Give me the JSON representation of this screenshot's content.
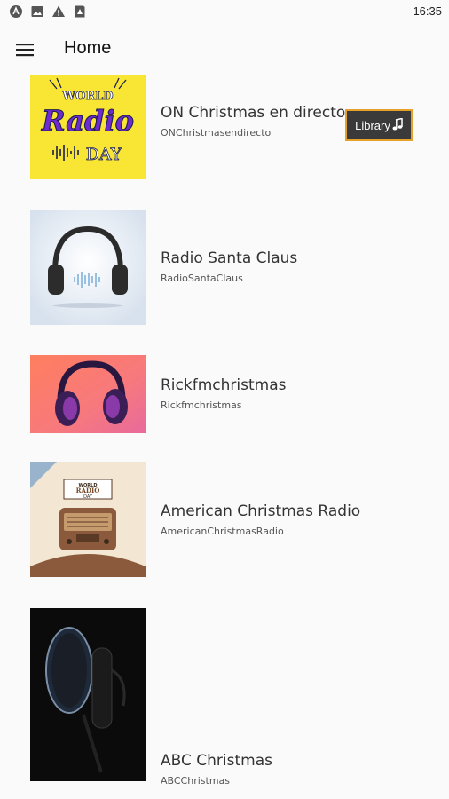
{
  "status_bar": {
    "time": "16:35",
    "icons": [
      "app-a-icon",
      "image-icon",
      "warning-icon",
      "sd-card-icon"
    ]
  },
  "app_bar": {
    "menu_icon": "hamburger-menu-icon",
    "title": "Home"
  },
  "library_badge": {
    "label": "Library",
    "icon": "music-note-icon"
  },
  "stations": [
    {
      "title": "ON Christmas en directo",
      "subtitle": "ONChristmasendirecto",
      "artwork": "world-radio-day",
      "art_text": [
        "WORLD",
        "Radio",
        "DAY"
      ]
    },
    {
      "title": "Radio Santa Claus",
      "subtitle": "RadioSantaClaus",
      "artwork": "white-headphones"
    },
    {
      "title": "Rickfmchristmas",
      "subtitle": "Rickfmchristmas",
      "artwork": "pink-headphones"
    },
    {
      "title": "American Christmas Radio",
      "subtitle": "AmericanChristmasRadio",
      "artwork": "vintage-radio",
      "art_text": [
        "WORLD",
        "RADIO",
        "DAY"
      ]
    },
    {
      "title": "ABC Christmas",
      "subtitle": "ABCChristmas",
      "artwork": "studio-microphone"
    }
  ],
  "colors": {
    "background": "#fafafa",
    "badge_border": "#e6a12a",
    "badge_bg": "#3a3a3a"
  }
}
